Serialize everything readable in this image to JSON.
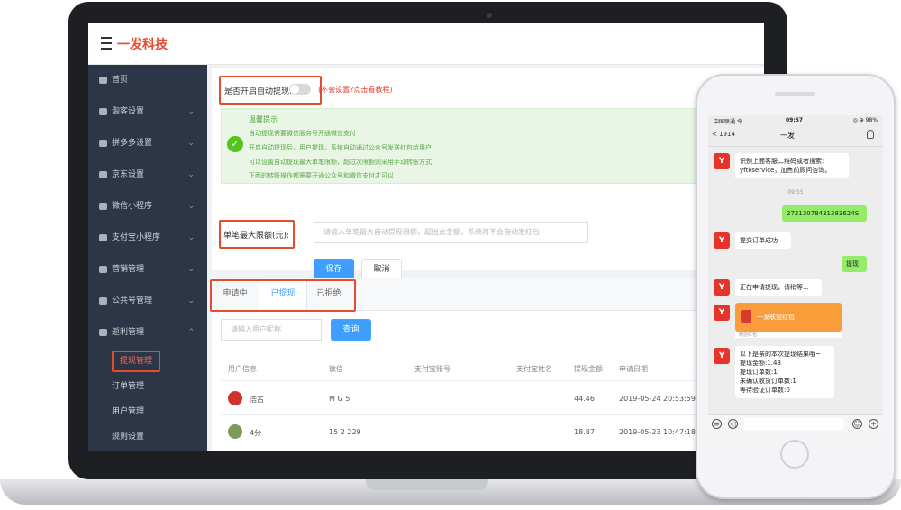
{
  "laptop": {
    "brand": "一发科技",
    "sidebar": {
      "items": [
        {
          "label": "首页",
          "icon": "dashboard-icon",
          "has_chevron": false
        },
        {
          "label": "淘客设置",
          "icon": "taobao-icon",
          "has_chevron": true
        },
        {
          "label": "拼多多设置",
          "icon": "pinduoduo-icon",
          "has_chevron": true
        },
        {
          "label": "京东设置",
          "icon": "jd-icon",
          "has_chevron": true
        },
        {
          "label": "微信小程序",
          "icon": "wechat-icon",
          "has_chevron": true
        },
        {
          "label": "支付宝小程序",
          "icon": "alipay-icon",
          "has_chevron": true
        },
        {
          "label": "营销管理",
          "icon": "marketing-icon",
          "has_chevron": true
        },
        {
          "label": "公共号管理",
          "icon": "official-account-icon",
          "has_chevron": true
        },
        {
          "label": "返利管理",
          "icon": "rebate-icon",
          "has_chevron": true,
          "expanded": true
        }
      ],
      "sub_items": [
        "提现管理",
        "订单管理",
        "用户管理",
        "规则设置"
      ],
      "active_sub": "提现管理"
    },
    "settings": {
      "auto_withdraw_label": "是否开启自动提现:",
      "auto_withdraw_enabled": false,
      "help_link": "(不会设置?点击看教程)",
      "tip_title": "温馨提示",
      "tips": [
        "自动提现需要微信服务号开通微信支付",
        "开启自动提现后，用户提现，系统自动通过公众号发送红包给用户",
        "可以设置自动提现最大单笔限额，超过次限额则采用手动转账方式",
        "下面的转账操作都需要开通公众号和微信支付才可以"
      ],
      "max_amount_label": "单笔最大限额(元):",
      "max_amount_placeholder": "请输入单笔最大自动提现限额，超出此金额，系统将不会自动发红包",
      "save": "保存",
      "cancel": "取消"
    },
    "tabs": [
      "申请中",
      "已提现",
      "已拒绝"
    ],
    "active_tab": "已提现",
    "search": {
      "placeholder": "请输入用户昵称",
      "button": "查询"
    },
    "table": {
      "headers": [
        "用户信息",
        "微信",
        "支付宝账号",
        "支付宝姓名",
        "提现金额",
        "申请日期"
      ],
      "rows": [
        {
          "user": "浩古",
          "wechat": "M    G    5",
          "alipay_account": "",
          "alipay_name": "",
          "amount": "44.46",
          "date": "2019-05-24 20:53:59"
        },
        {
          "user": "4分",
          "wechat": "15    2    229",
          "alipay_account": "",
          "alipay_name": "",
          "amount": "18.87",
          "date": "2019-05-23 10:47:18"
        }
      ]
    }
  },
  "phone": {
    "status": {
      "carrier": "中国联通 令",
      "time": "09:57",
      "battery": "◎ ⊕ 98%"
    },
    "chat": {
      "back": "< 1914",
      "title": "一发",
      "messages": [
        {
          "from": "bot",
          "text": "识别上面客服二维码或者搜索: yftkservice，加售前顾问咨询。"
        },
        {
          "type": "time",
          "text": "09:55"
        },
        {
          "from": "user",
          "text": "27213078431383624S"
        },
        {
          "from": "bot",
          "text": "提交订单成功"
        },
        {
          "from": "user",
          "text": "提现"
        },
        {
          "from": "bot",
          "text": "正在申请提现，请稍等..."
        },
        {
          "from": "bot",
          "type": "redpacket",
          "text": "一发联盟红包",
          "sub": "微信红包"
        },
        {
          "from": "bot",
          "lines": [
            "以下是亲的本次提现结果哦~",
            "提现金额:1.43",
            "提现订单数:1",
            "未确认收货订单数:1",
            "等待验证订单数:0"
          ]
        }
      ]
    }
  }
}
